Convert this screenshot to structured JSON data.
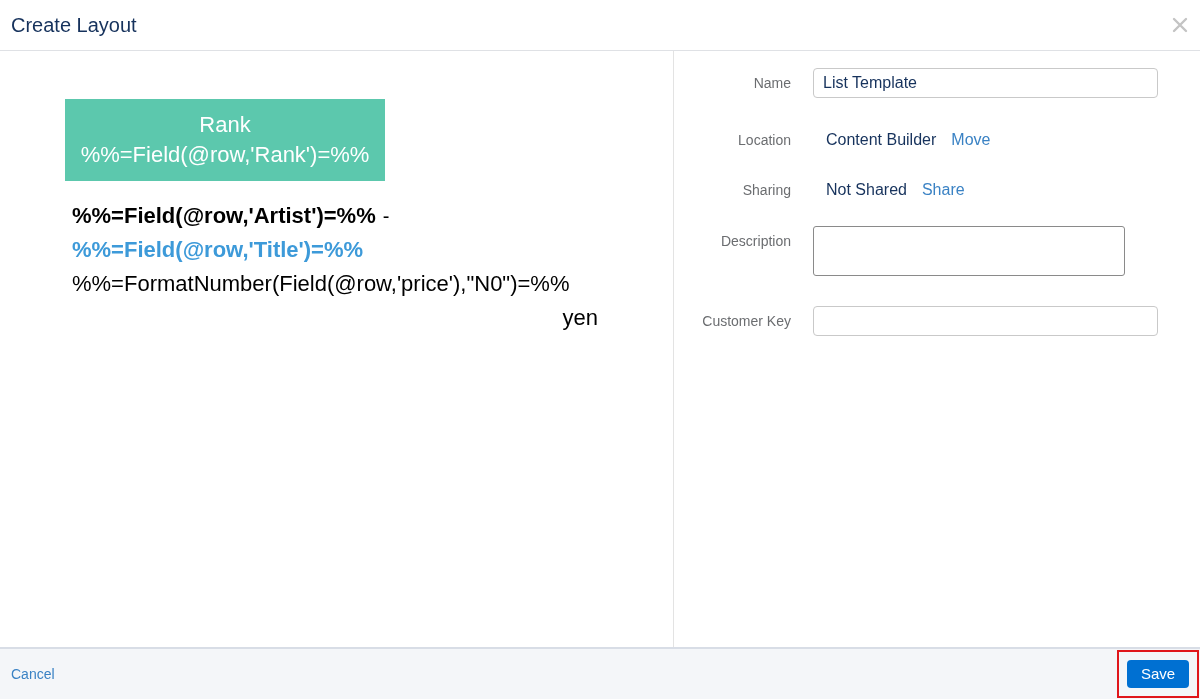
{
  "dialog": {
    "title": "Create Layout"
  },
  "preview": {
    "header_block": {
      "label": "Rank",
      "expression": "%%=Field(@row,'Rank')=%%"
    },
    "artist_expression": "%%=Field(@row,'Artist')=%%",
    "separator": "-",
    "title_expression": "%%=Field(@row,'Title')=%%",
    "price_expression": "%%=FormatNumber(Field(@row,'price'),\"N0\")=%%",
    "price_unit": "yen"
  },
  "form": {
    "fields": [
      {
        "kind": "input",
        "label": "Name",
        "value": "List Template"
      },
      {
        "kind": "link",
        "label": "Location",
        "value": "Content Builder",
        "action": "Move"
      },
      {
        "kind": "link",
        "label": "Sharing",
        "value": "Not Shared",
        "action": "Share"
      },
      {
        "kind": "textarea",
        "label": "Description"
      },
      {
        "kind": "input",
        "label": "Customer Key"
      }
    ]
  },
  "footer": {
    "cancel": "Cancel",
    "save": {
      "label": "Save",
      "highlighted": true
    }
  }
}
